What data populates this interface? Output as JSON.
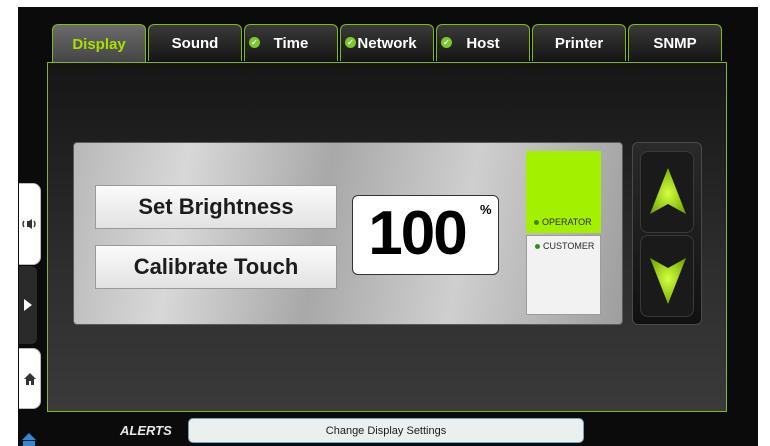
{
  "tabs": [
    {
      "label": "Display",
      "active": true,
      "checked": false
    },
    {
      "label": "Sound",
      "active": false,
      "checked": false
    },
    {
      "label": "Time",
      "active": false,
      "checked": true
    },
    {
      "label": "Network",
      "active": false,
      "checked": true
    },
    {
      "label": "Host",
      "active": false,
      "checked": true
    },
    {
      "label": "Printer",
      "active": false,
      "checked": false
    },
    {
      "label": "SNMP",
      "active": false,
      "checked": false
    }
  ],
  "display": {
    "set_brightness_label": "Set Brightness",
    "calibrate_touch_label": "Calibrate Touch",
    "brightness_value": "100",
    "brightness_unit": "%"
  },
  "mode": {
    "operator_label": "OPERATOR",
    "customer_label": "CUSTOMER",
    "selected": "OPERATOR"
  },
  "alerts": {
    "label": "ALERTS",
    "message": "Change Display Settings"
  },
  "colors": {
    "accent": "#a3f000",
    "tab_border": "#7dbb1a",
    "active_tab_text": "#a8e000"
  },
  "icons": {
    "sound_rail": "speaker-waves-icon",
    "expand_rail": "play-icon",
    "home_rail": "home-icon",
    "up": "up-arrow-icon",
    "down": "down-arrow-icon",
    "tab_check": "check-circle-icon"
  }
}
